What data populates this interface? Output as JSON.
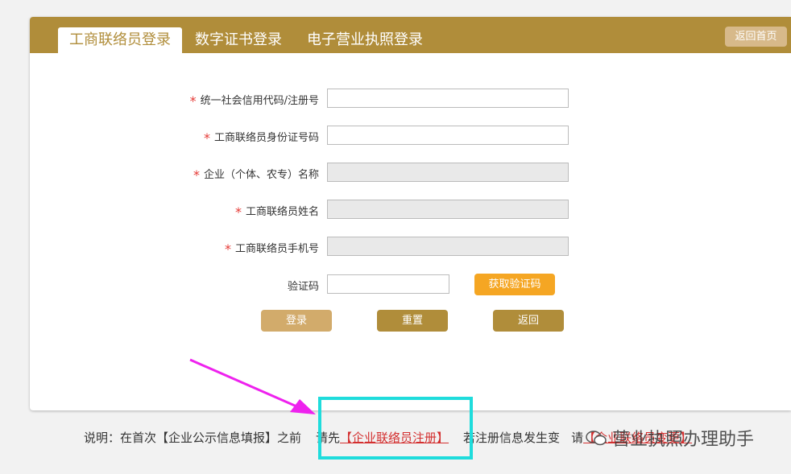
{
  "tabs": [
    {
      "label": "工商联络员登录",
      "active": true
    },
    {
      "label": "数字证书登录",
      "active": false
    },
    {
      "label": "电子营业执照登录",
      "active": false
    }
  ],
  "home_button": "返回首页",
  "form": {
    "credit_code_label": "统一社会信用代码/注册号",
    "id_number_label": "工商联络员身份证号码",
    "company_name_label": "企业（个体、农专）名称",
    "contact_name_label": "工商联络员姓名",
    "phone_label": "工商联络员手机号",
    "captcha_label": "验证码",
    "required_mark": "*"
  },
  "buttons": {
    "get_code": "获取验证码",
    "login": "登录",
    "reset": "重置",
    "back": "返回"
  },
  "note": {
    "prefix": "说明：在首次【企业公示信息填报】之前",
    "register_prefix": "请先",
    "register_link": "【企业联络员注册】",
    "suffix": "若注册信息发生变",
    "suffix2": "请",
    "change_link": "【企业联络员变更】"
  },
  "watermark": "营业执照办理助手",
  "colors": {
    "brand": "#b08d3a",
    "brand_light": "#d2ab6b",
    "orange": "#f5a623",
    "required": "#e53935",
    "highlight": "#1fdcdc",
    "arrow": "#ee22ee"
  }
}
